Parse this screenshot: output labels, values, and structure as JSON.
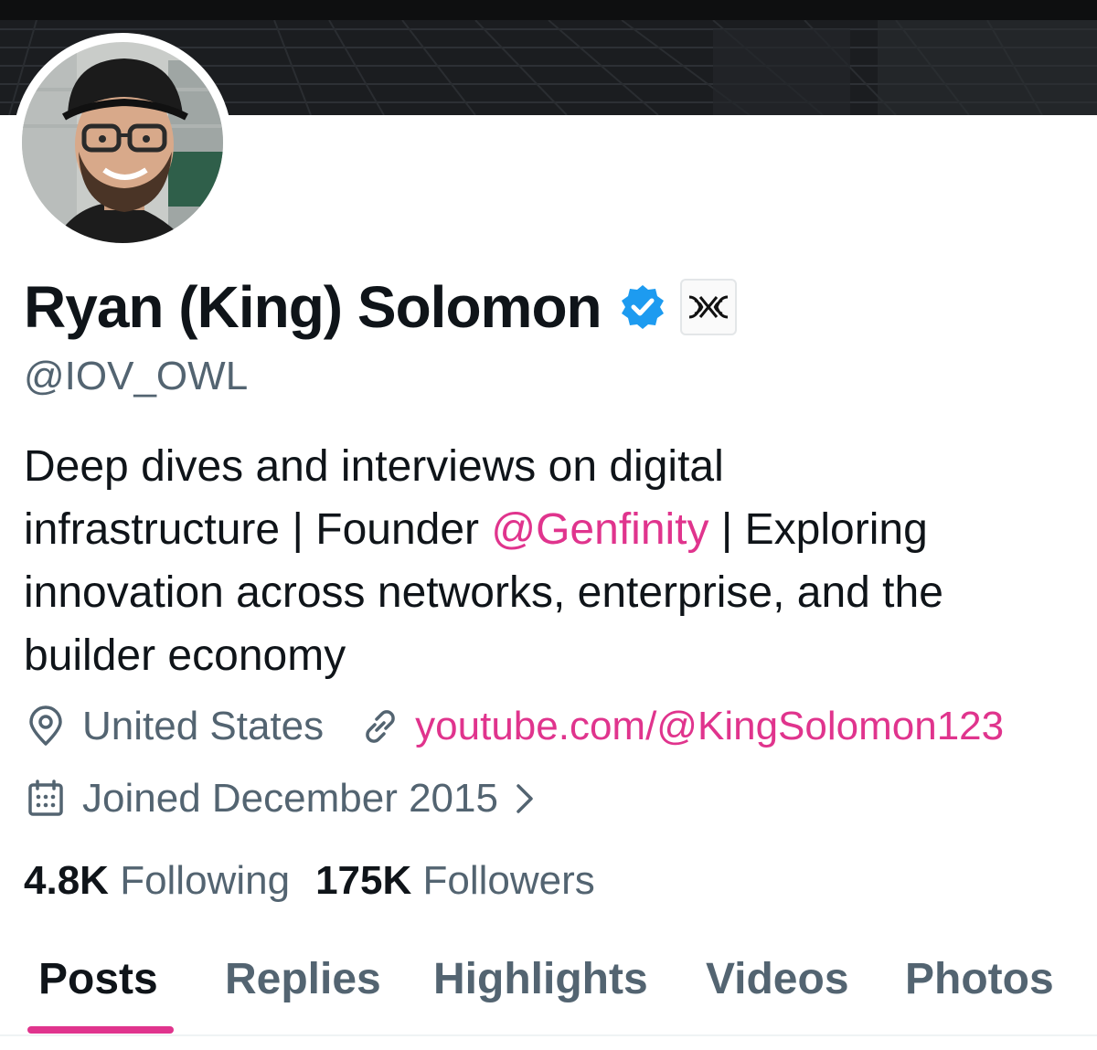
{
  "profile": {
    "display_name": "Ryan (King) Solomon",
    "handle": "@IOV_OWL",
    "verified_icon": "verified-badge-icon",
    "affiliate_icon": "affiliate-logo-icon",
    "bio": {
      "line1": "Deep dives and interviews on digital",
      "line2_before": "infrastructure | Founder ",
      "mention": "@Genfinity",
      "line2_after": " | Exploring",
      "line3": "innovation across networks, enterprise, and the",
      "line4": "builder economy"
    },
    "location": "United States",
    "website": "youtube.com/@KingSolomon123",
    "joined": "Joined December 2015",
    "following_count": "4.8K",
    "following_label": "Following",
    "followers_count": "175K",
    "followers_label": "Followers"
  },
  "tabs": [
    {
      "label": "Posts",
      "active": true
    },
    {
      "label": "Replies"
    },
    {
      "label": "Highlights"
    },
    {
      "label": "Videos"
    },
    {
      "label": "Photos"
    }
  ],
  "colors": {
    "accent": "#e0348d",
    "verified": "#1d9bf0",
    "text": "#0f1419",
    "secondary": "#536471"
  }
}
